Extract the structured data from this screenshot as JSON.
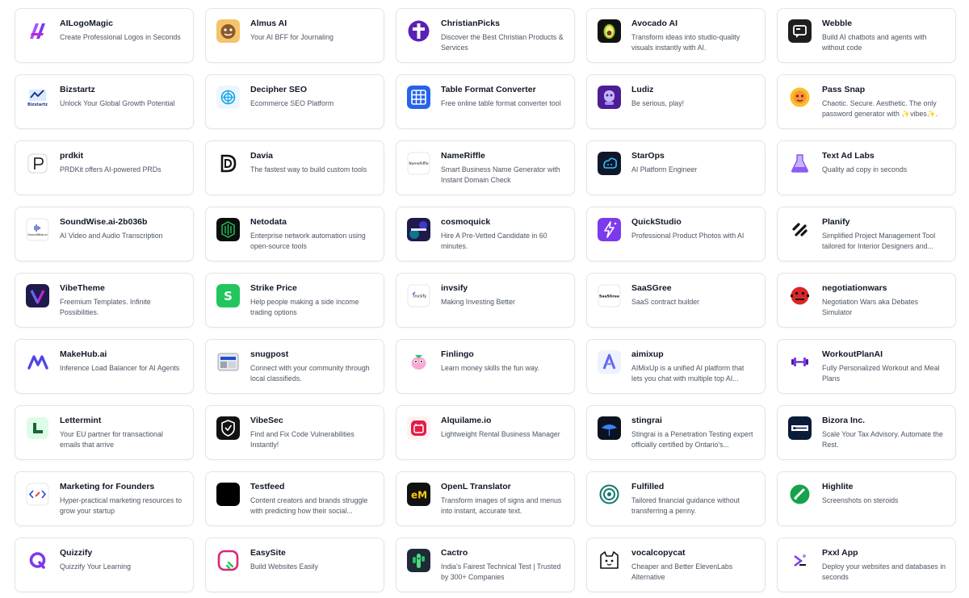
{
  "cards": [
    {
      "name": "AILogoMagic",
      "desc": "Create Professional Logos in Seconds",
      "icon": "ailogomagic-logo-icon",
      "color": "#7c3aed"
    },
    {
      "name": "Almus AI",
      "desc": "Your AI BFF for Journaling",
      "icon": "almus-logo-icon",
      "color": "#f5c36b"
    },
    {
      "name": "ChristianPicks",
      "desc": "Discover the Best Christian Products & Services",
      "icon": "christianpicks-logo-icon",
      "color": "#5b21b6"
    },
    {
      "name": "Avocado AI",
      "desc": "Transform ideas into studio-quality visuals instantly with AI.",
      "icon": "avocado-logo-icon",
      "color": "#111111"
    },
    {
      "name": "Webble",
      "desc": "Build AI chatbots and agents with without code",
      "icon": "webble-logo-icon",
      "color": "#1f1f1f"
    },
    {
      "name": "Bizstartz",
      "desc": "Unlock Your Global Growth Potential",
      "icon": "bizstartz-logo-icon",
      "color": "#1e3a8a",
      "logo_text": "Bizstartz"
    },
    {
      "name": "Decipher SEO",
      "desc": "Ecommerce SEO Platform",
      "icon": "decipher-seo-logo-icon",
      "color": "#0ea5e9"
    },
    {
      "name": "Table Format Converter",
      "desc": "Free online table format converter tool",
      "icon": "table-converter-logo-icon",
      "color": "#2563eb"
    },
    {
      "name": "Ludiz",
      "desc": "Be serious, play!",
      "icon": "ludiz-logo-icon",
      "color": "#4c1d95"
    },
    {
      "name": "Pass Snap",
      "desc": "Chaotic. Secure. Aesthetic. The only password generator with ✨vibes✨.",
      "icon": "passsnap-logo-icon",
      "color": "#f59e0b"
    },
    {
      "name": "prdkit",
      "desc": "PRDKit offers AI-powered PRDs",
      "icon": "prdkit-logo-icon",
      "color": "#111111"
    },
    {
      "name": "Davia",
      "desc": "The fastest way to build custom tools",
      "icon": "davia-logo-icon",
      "color": "#111111"
    },
    {
      "name": "NameRiffle",
      "desc": "Smart Business Name Generator with Instant Domain Check",
      "icon": "nameriffle-logo-icon",
      "color": "#111111",
      "logo_text": "NameRiffle"
    },
    {
      "name": "StarOps",
      "desc": "AI Platform Engineer",
      "icon": "starops-logo-icon",
      "color": "#0f172a"
    },
    {
      "name": "Text Ad Labs",
      "desc": "Quality ad copy in seconds",
      "icon": "textadlabs-logo-icon",
      "color": "#8b5cf6"
    },
    {
      "name": "SoundWise.ai-2b036b",
      "desc": "AI Video and Audio Transcription",
      "icon": "soundwise-logo-icon",
      "color": "#1e40af",
      "logo_text": "SoundWise.ai"
    },
    {
      "name": "Netodata",
      "desc": "Enterprise network automation using open-source tools",
      "icon": "netodata-logo-icon",
      "color": "#0b0f0c"
    },
    {
      "name": "cosmoquick",
      "desc": "Hire A Pre-Vetted Candidate in 60 minutes.",
      "icon": "cosmoquick-logo-icon",
      "color": "#1e1b4b"
    },
    {
      "name": "QuickStudio",
      "desc": "Professional Product Photos with AI",
      "icon": "quickstudio-logo-icon",
      "color": "#7c3aed"
    },
    {
      "name": "Planify",
      "desc": "Simplified Project Management Tool tailored for Interior Designers and...",
      "icon": "planify-logo-icon",
      "color": "#111111"
    },
    {
      "name": "VibeTheme",
      "desc": "Freemium Templates. Infinite Possibilities.",
      "icon": "vibetheme-logo-icon",
      "color": "#1e1b4b"
    },
    {
      "name": "Strike Price",
      "desc": "Help people making a side income trading options",
      "icon": "strikeprice-logo-icon",
      "color": "#22c55e"
    },
    {
      "name": "invsify",
      "desc": "Making Investing Better",
      "icon": "invsify-logo-icon",
      "color": "#111111",
      "logo_text": "Invsify"
    },
    {
      "name": "SaaSGree",
      "desc": "SaaS contract builder",
      "icon": "saasgree-logo-icon",
      "color": "#111111",
      "logo_text": "SaaSGree"
    },
    {
      "name": "negotiationwars",
      "desc": "Negotiation Wars aka Debates Simulator",
      "icon": "negotiationwars-logo-icon",
      "color": "#dc2626"
    },
    {
      "name": "MakeHub.ai",
      "desc": "Inference Load Balancer for AI Agents",
      "icon": "makehub-logo-icon",
      "color": "#4f46e5"
    },
    {
      "name": "snugpost",
      "desc": "Connect with your community through local classifieds.",
      "icon": "snugpost-logo-icon",
      "color": "#6b7280"
    },
    {
      "name": "Finlingo",
      "desc": "Learn money skills the fun way.",
      "icon": "finlingo-logo-icon",
      "color": "#ec4899"
    },
    {
      "name": "aimixup",
      "desc": "AIMixUp is a unified AI platform that lets you chat with multiple top AI...",
      "icon": "aimixup-logo-icon",
      "color": "#6366f1"
    },
    {
      "name": "WorkoutPlanAI",
      "desc": "Fully Personalized Workout and Meal Plans",
      "icon": "workoutplanai-logo-icon",
      "color": "#4c1d95"
    },
    {
      "name": "Lettermint",
      "desc": "Your EU partner for transactional emails that arrive",
      "icon": "lettermint-logo-icon",
      "color": "#166534"
    },
    {
      "name": "VibeSec",
      "desc": "Find and Fix Code Vulnerabilities Instantly!",
      "icon": "vibesec-logo-icon",
      "color": "#111111"
    },
    {
      "name": "Alquilame.io",
      "desc": "Lightweight Rental Business Manager",
      "icon": "alquilame-logo-icon",
      "color": "#e11d48"
    },
    {
      "name": "stingrai",
      "desc": "Stingrai is a Penetration Testing expert officially certified by Ontario's...",
      "icon": "stingrai-logo-icon",
      "color": "#0b1220"
    },
    {
      "name": "Bizora Inc.",
      "desc": "Scale Your Tax Advisory. Automate the Rest.",
      "icon": "bizora-logo-icon",
      "color": "#0b1b3a"
    },
    {
      "name": "Marketing for Founders",
      "desc": "Hyper-practical marketing resources to grow your startup",
      "icon": "marketing-founders-logo-icon",
      "color": "#1d4ed8"
    },
    {
      "name": "Testfeed",
      "desc": "Content creators and brands struggle with predicting how their social...",
      "icon": "testfeed-logo-icon",
      "color": "#000000"
    },
    {
      "name": "OpenL Translator",
      "desc": "Transform images of signs and menus into instant, accurate text.",
      "icon": "openl-logo-icon",
      "color": "#111111"
    },
    {
      "name": "Fulfilled",
      "desc": "Tailored financial guidance without transferring a penny.",
      "icon": "fulfilled-logo-icon",
      "color": "#0f766e"
    },
    {
      "name": "Highlite",
      "desc": "Screenshots on steroids",
      "icon": "highlite-logo-icon",
      "color": "#16a34a"
    },
    {
      "name": "Quizzify",
      "desc": "Quizzify Your Learning",
      "icon": "quizzify-logo-icon",
      "color": "#7c3aed"
    },
    {
      "name": "EasySite",
      "desc": "Build Websites Easily",
      "icon": "easysite-logo-icon",
      "color": "#db2777"
    },
    {
      "name": "Cactro",
      "desc": "India's Fairest Technical Test | Trusted by 300+ Companies",
      "icon": "cactro-logo-icon",
      "color": "#1f2937"
    },
    {
      "name": "vocalcopycat",
      "desc": "Cheaper and Better ElevenLabs Alternative",
      "icon": "vocalcopycat-logo-icon",
      "color": "#111111"
    },
    {
      "name": "Pxxl App",
      "desc": "Deploy your websites and databases in seconds",
      "icon": "pxxl-logo-icon",
      "color": "#7c3aed"
    }
  ]
}
